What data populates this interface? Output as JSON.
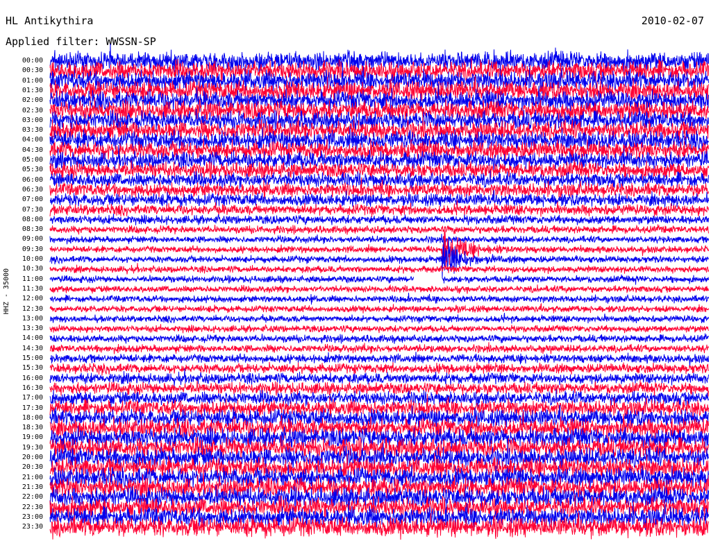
{
  "header": {
    "station": "HL Antikythira",
    "date": "2010-02-07",
    "filter": "Applied filter: WWSSN-SP"
  },
  "chart_data": {
    "type": "line",
    "title": "HL Antikythira",
    "ylabel": "HHZ - 35000",
    "row_labels": [
      "00:00",
      "00:30",
      "01:00",
      "01:30",
      "02:00",
      "02:30",
      "03:00",
      "03:30",
      "04:00",
      "04:30",
      "05:00",
      "05:30",
      "06:00",
      "06:30",
      "07:00",
      "07:30",
      "08:00",
      "08:30",
      "09:00",
      "09:30",
      "10:00",
      "10:30",
      "11:00",
      "11:30",
      "12:00",
      "12:30",
      "13:00",
      "13:30",
      "14:00",
      "14:30",
      "15:00",
      "15:30",
      "16:00",
      "16:30",
      "17:00",
      "17:30",
      "18:00",
      "18:30",
      "19:00",
      "19:30",
      "20:00",
      "20:30",
      "21:00",
      "21:30",
      "22:00",
      "22:30",
      "23:00",
      "23:30"
    ],
    "series_colors": [
      "#0000ee",
      "#ff0033"
    ],
    "row_amplitude": [
      1.0,
      1.0,
      1.0,
      1.0,
      1.0,
      1.0,
      0.95,
      0.95,
      0.95,
      0.9,
      0.85,
      0.8,
      0.75,
      0.7,
      0.65,
      0.55,
      0.45,
      0.4,
      0.35,
      0.35,
      0.35,
      0.35,
      0.35,
      0.35,
      0.35,
      0.35,
      0.35,
      0.35,
      0.4,
      0.4,
      0.45,
      0.5,
      0.55,
      0.6,
      0.7,
      0.8,
      0.9,
      0.95,
      1.0,
      1.0,
      1.0,
      1.0,
      1.0,
      1.0,
      1.0,
      1.0,
      1.0,
      1.0
    ],
    "events": [
      {
        "row_label": "09:30",
        "time_fraction": 0.595,
        "amplitude": 3.0,
        "note": "event onset"
      },
      {
        "row_label": "10:00",
        "time_fraction": 0.595,
        "amplitude": 2.5,
        "note": "coda"
      }
    ],
    "data_gap": {
      "row_label": "11:00",
      "start_fraction": 0.552,
      "end_fraction": 0.595
    },
    "grid": false
  }
}
